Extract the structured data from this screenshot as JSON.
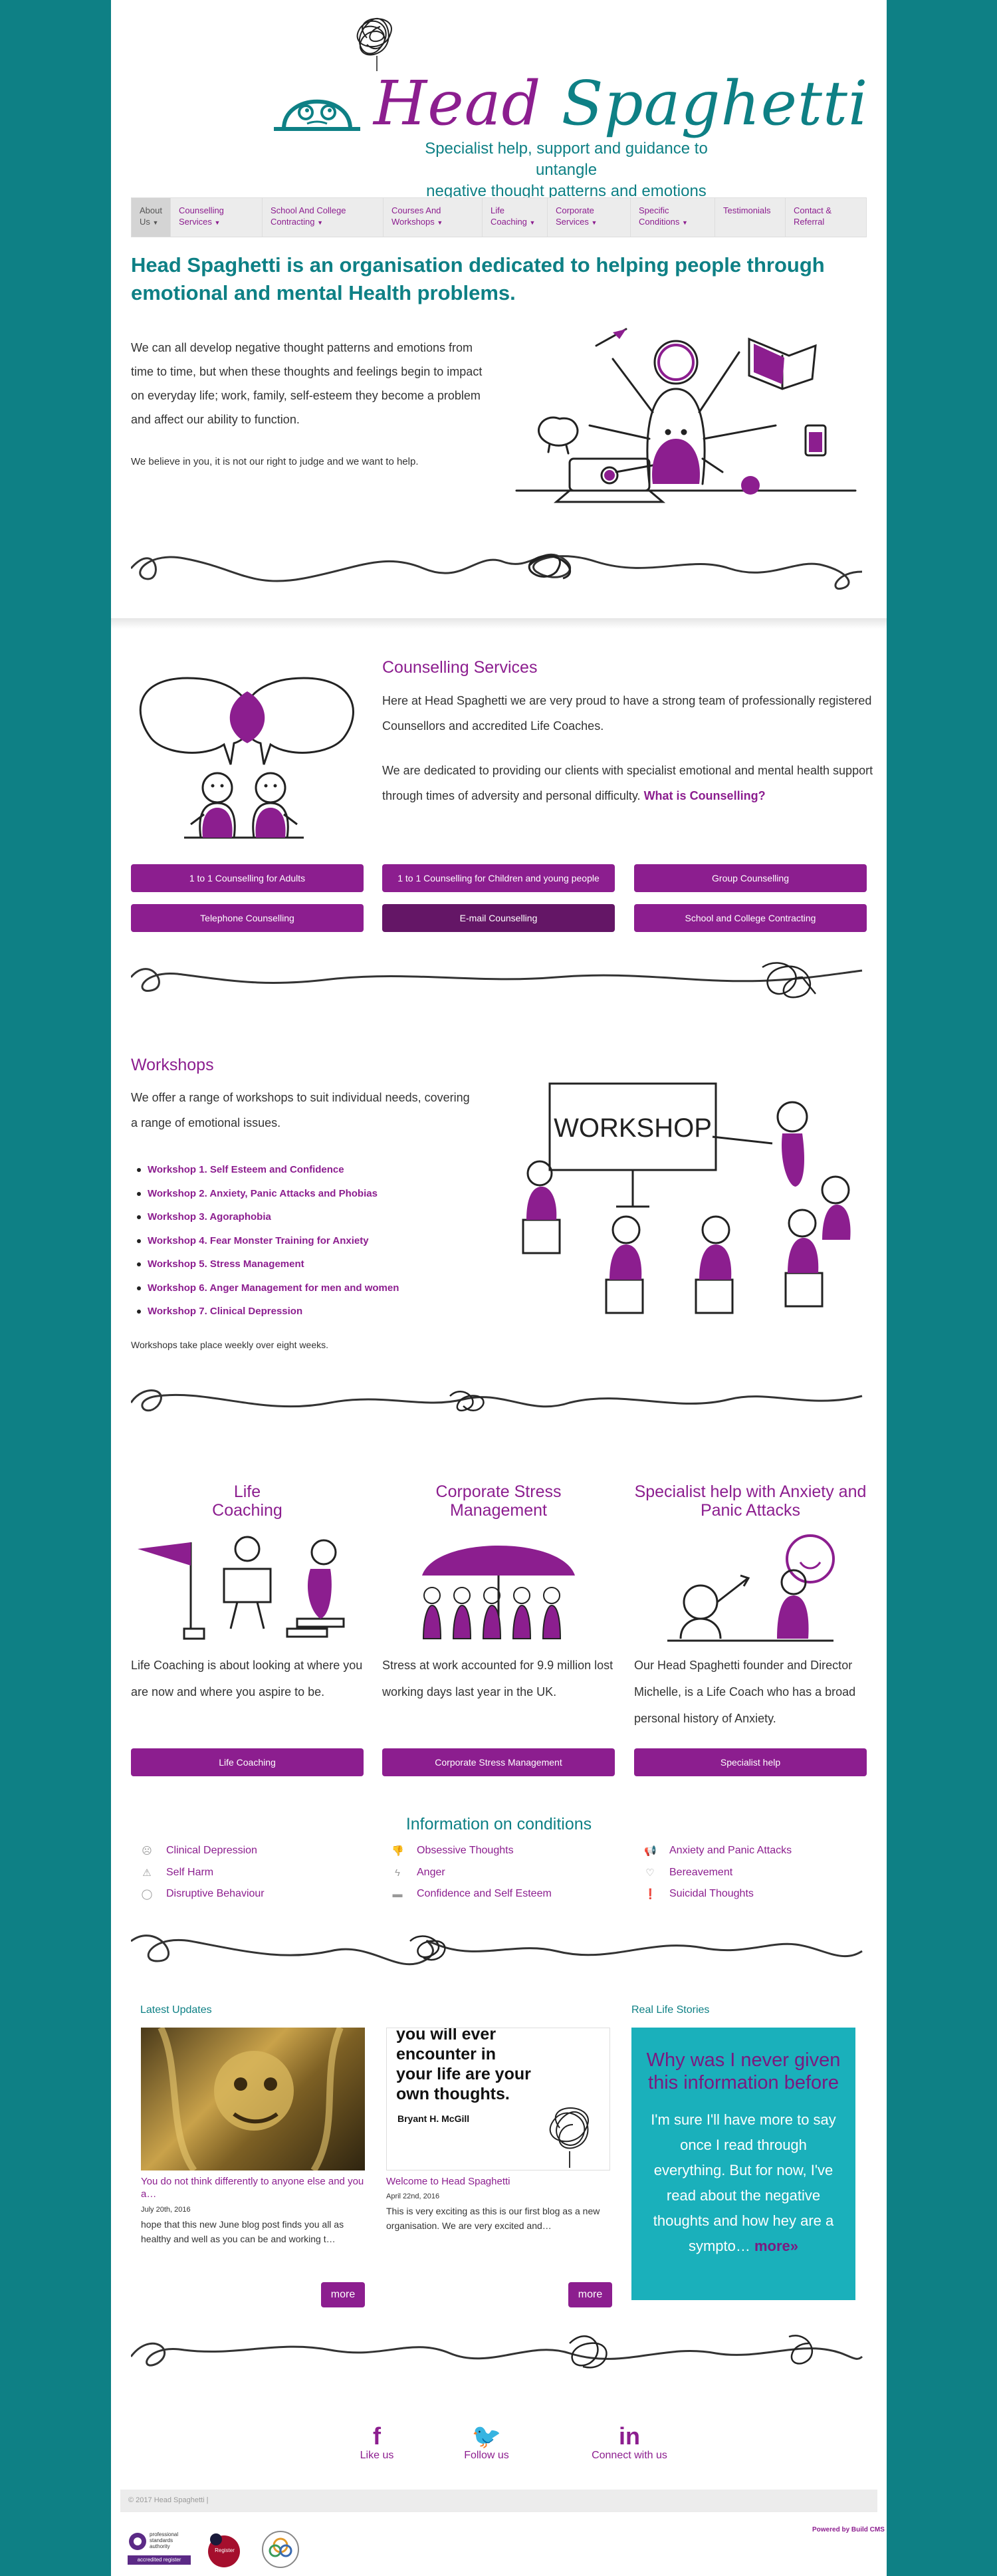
{
  "header": {
    "title_part1": "Head",
    "title_part2": "Spaghetti",
    "tagline_line1": "Specialist help, support and guidance to untangle",
    "tagline_line2": "negative thought patterns and emotions"
  },
  "nav": {
    "items": [
      {
        "line1": "About",
        "line2": "Us"
      },
      {
        "line1": "Counselling",
        "line2": "Services"
      },
      {
        "line1": "School And College",
        "line2": "Contracting"
      },
      {
        "line1": "Courses And",
        "line2": "Workshops"
      },
      {
        "line1": "Life",
        "line2": "Coaching"
      },
      {
        "line1": "Corporate",
        "line2": "Services"
      },
      {
        "line1": "Specific",
        "line2": "Conditions"
      },
      {
        "line1": "Testimonials",
        "line2": ""
      },
      {
        "line1": "Contact &",
        "line2": "Referral"
      }
    ]
  },
  "intro": {
    "heading": "Head Spaghetti is an organisation dedicated to helping people through emotional and mental Health problems.",
    "paragraph": "We can all develop negative thought patterns and emotions from time to time, but when these thoughts and feelings begin to impact on everyday life; work, family, self-esteem they become a problem and affect our ability to function.",
    "small": "We believe in you, it is not our right to judge and we want to help."
  },
  "counselling": {
    "title": "Counselling Services",
    "p1": "Here at Head Spaghetti we are very proud to have a strong team of professionally registered Counsellors and accredited Life Coaches.",
    "p2": "We are dedicated to providing our clients with specialist emotional and mental health support through times of adversity and personal difficulty.",
    "link": "What is Counselling?",
    "buttons": [
      "1 to 1 Counselling for Adults",
      "1 to 1 Counselling for Children and young people",
      "Group Counselling",
      "Telephone Counselling",
      "E-mail Counselling",
      "School and College Contracting"
    ]
  },
  "workshops": {
    "title": "Workshops",
    "intro": "We offer a range of workshops to suit individual needs, covering a range of emotional issues.",
    "board": "WORKSHOP",
    "items": [
      "Workshop 1. Self Esteem and Confidence",
      "Workshop 2. Anxiety, Panic Attacks and Phobias",
      "Workshop 3. Agoraphobia",
      "Workshop 4. Fear Monster Training for Anxiety",
      "Workshop 5. Stress Management",
      "Workshop 6. Anger Management for men and women",
      "Workshop 7. Clinical Depression"
    ],
    "note": "Workshops take place weekly over eight weeks."
  },
  "columns": [
    {
      "title_line1": "Life",
      "title_line2": "Coaching",
      "text": "Life Coaching is about looking at where you are now and where you aspire to be.",
      "button": "Life Coaching"
    },
    {
      "title_line1": "Corporate Stress",
      "title_line2": "Management",
      "text": "Stress at work accounted for 9.9 million lost working days last year in the UK.",
      "button": "Corporate Stress Management"
    },
    {
      "title_line1": "Specialist help with Anxiety and",
      "title_line2": "Panic Attacks",
      "text": "Our Head Spaghetti founder and Director Michelle, is a Life Coach who has a broad personal history of Anxiety.",
      "button": "Specialist help"
    }
  ],
  "conditions": {
    "title": "Information on conditions",
    "items": [
      {
        "label": "Clinical Depression",
        "icon": "frown-icon"
      },
      {
        "label": "Self Harm",
        "icon": "warning-icon"
      },
      {
        "label": "Disruptive Behaviour",
        "icon": "circle-icon"
      },
      {
        "label": "Obsessive Thoughts",
        "icon": "thumbs-down-icon"
      },
      {
        "label": "Anger",
        "icon": "bolt-icon"
      },
      {
        "label": "Confidence and Self Esteem",
        "icon": "bed-icon"
      },
      {
        "label": "Anxiety and Panic Attacks",
        "icon": "megaphone-icon"
      },
      {
        "label": "Bereavement",
        "icon": "heart-icon"
      },
      {
        "label": "Suicidal Thoughts",
        "icon": "exclamation-icon"
      }
    ]
  },
  "updates": {
    "title": "Latest Updates",
    "posts": [
      {
        "title": "You do not think differently to anyone else and you a…",
        "date": "July 20th, 2016",
        "excerpt": "hope that this new June blog post finds you all as healthy and well as you can be and working t…",
        "more": "more"
      },
      {
        "title": "Welcome to Head Spaghetti",
        "date": "April 22nd, 2016",
        "excerpt": "This is very exciting as this is our first blog as a new organisation. We are very excited and…",
        "more": "more",
        "quote_line1": "you will ever",
        "quote_line2": "encounter in",
        "quote_line3": "your life are your",
        "quote_line4": "own thoughts.",
        "quote_author": "Bryant H. McGill"
      }
    ]
  },
  "stories": {
    "title": "Real Life Stories",
    "heading": "Why was I never given this information before",
    "text": "I'm sure I'll have more to say once I read through everything. But for now, I've read about the negative thoughts and how hey are a sympto…",
    "more": "more»"
  },
  "social": [
    {
      "label": "Like us",
      "icon": "facebook-icon",
      "glyph": "f"
    },
    {
      "label": "Follow us",
      "icon": "twitter-icon",
      "glyph": "🐦"
    },
    {
      "label": "Connect with us",
      "icon": "linkedin-icon",
      "glyph": "in"
    }
  ],
  "footer": {
    "copyright": "© 2017 Head Spaghetti |",
    "powered": "Powered by Build CMS",
    "badge1_line1": "professional",
    "badge1_line2": "standards",
    "badge1_line3": "authority",
    "badge1_label": "accredited register",
    "badge2": "Register"
  },
  "colors": {
    "purple": "#8c1e8f",
    "teal": "#0e8085",
    "story_bg": "#1ab0bb"
  }
}
